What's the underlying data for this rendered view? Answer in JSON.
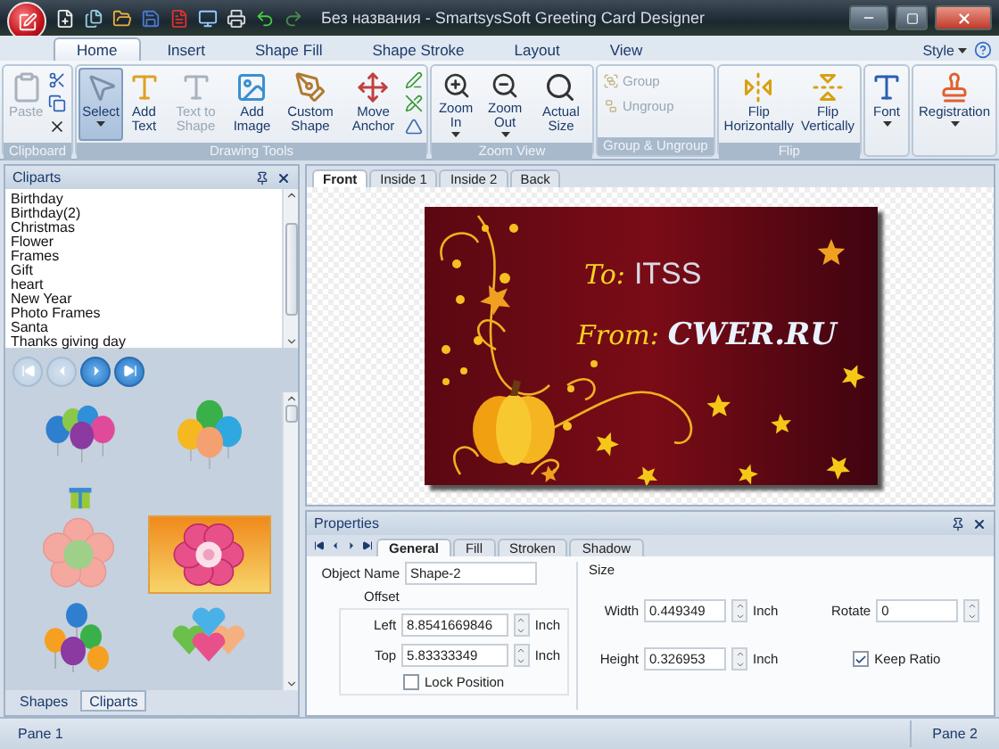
{
  "window": {
    "title": "Без названия - SmartsysSoft Greeting Card Designer"
  },
  "ribbon": {
    "tabs": [
      {
        "label": "Home",
        "selected": true
      },
      {
        "label": "Insert",
        "selected": false
      },
      {
        "label": "Shape Fill",
        "selected": false
      },
      {
        "label": "Shape Stroke",
        "selected": false
      },
      {
        "label": "Layout",
        "selected": false
      },
      {
        "label": "View",
        "selected": false
      }
    ],
    "style_menu": {
      "label": "Style"
    },
    "groups": [
      {
        "kind": "clipboard",
        "label": "Clipboard",
        "buttons": [
          {
            "kind": "large",
            "label": "Paste",
            "disabled": true
          }
        ]
      },
      {
        "kind": "drawing",
        "label": "Drawing Tools",
        "buttons": [
          {
            "kind": "large",
            "label": "Select",
            "disabled": false,
            "selected": true,
            "dropdown": true
          },
          {
            "kind": "large",
            "label": "Add Text",
            "disabled": false,
            "selected": false
          },
          {
            "kind": "large",
            "label": "Text to Shape",
            "disabled": true,
            "selected": false
          },
          {
            "kind": "large",
            "label": "Add Image",
            "disabled": false,
            "selected": false
          },
          {
            "kind": "large",
            "label": "Custom Shape",
            "disabled": false,
            "selected": false
          },
          {
            "kind": "large",
            "label": "Move Anchor",
            "disabled": false,
            "selected": false
          }
        ]
      },
      {
        "kind": "zoom",
        "label": "Zoom View",
        "buttons": [
          {
            "kind": "large",
            "label": "Zoom In",
            "disabled": false,
            "dropdown": true
          },
          {
            "kind": "large",
            "label": "Zoom Out",
            "disabled": false,
            "dropdown": true
          },
          {
            "kind": "large",
            "label": "Actual Size",
            "disabled": false
          }
        ]
      },
      {
        "kind": "grouping",
        "label": "Group & Ungroup",
        "buttons": [
          {
            "kind": "small",
            "label": "Group",
            "disabled": true
          },
          {
            "kind": "small",
            "label": "Ungroup",
            "disabled": true
          }
        ]
      },
      {
        "kind": "flip",
        "label": "Flip",
        "buttons": [
          {
            "kind": "large",
            "label": "Flip Horizontally",
            "disabled": false
          },
          {
            "kind": "large",
            "label": "Flip Vertically",
            "disabled": false
          }
        ]
      },
      {
        "kind": "font",
        "buttons": [
          {
            "kind": "large",
            "label": "Font",
            "disabled": false,
            "dropdown": true
          }
        ]
      },
      {
        "kind": "registration",
        "buttons": [
          {
            "kind": "large",
            "label": "Registration",
            "disabled": false,
            "dropdown": true
          }
        ]
      }
    ]
  },
  "cliparts_panel": {
    "title": "Cliparts",
    "categories": [
      {
        "label": "Birthday",
        "selected": false
      },
      {
        "label": "Birthday(2)",
        "selected": false
      },
      {
        "label": "Christmas",
        "selected": false
      },
      {
        "label": "Flower",
        "selected": false
      },
      {
        "label": "Frames",
        "selected": false
      },
      {
        "label": "Gift",
        "selected": false
      },
      {
        "label": "heart",
        "selected": false
      },
      {
        "label": "New Year",
        "selected": false
      },
      {
        "label": "Photo Frames",
        "selected": false
      },
      {
        "label": "Santa",
        "selected": false
      },
      {
        "label": "Thanks giving day",
        "selected": false
      }
    ],
    "pager": [
      {
        "kind": "first",
        "disabled": true
      },
      {
        "kind": "prev",
        "disabled": true
      },
      {
        "kind": "next",
        "disabled": false
      },
      {
        "kind": "last",
        "disabled": false
      }
    ],
    "thumbnails": [
      {
        "kind": "balloons",
        "selected": false
      },
      {
        "kind": "balloons_big",
        "selected": false
      },
      {
        "kind": "gift",
        "selected": false
      },
      {
        "kind": "flower",
        "selected": false
      },
      {
        "kind": "flower_hearts",
        "selected": true
      },
      {
        "kind": "balloons_small",
        "selected": false
      },
      {
        "kind": "hearts",
        "selected": false
      }
    ],
    "tabs": [
      {
        "label": "Shapes",
        "selected": false
      },
      {
        "label": "Cliparts",
        "selected": true
      }
    ]
  },
  "document_tabs": [
    {
      "label": "Front",
      "selected": true
    },
    {
      "label": "Inside 1",
      "selected": false
    },
    {
      "label": "Inside 2",
      "selected": false
    },
    {
      "label": "Back",
      "selected": false
    }
  ],
  "card": {
    "to_label": "To:",
    "to_value": "ITSS",
    "from_label": "From:",
    "from_value": "CWER.RU"
  },
  "properties": {
    "title": "Properties",
    "tabs": [
      {
        "label": "General",
        "selected": true
      },
      {
        "label": "Fill",
        "selected": false
      },
      {
        "label": "Stroken",
        "selected": false
      },
      {
        "label": "Shadow",
        "selected": false
      }
    ],
    "object_name": {
      "label": "Object Name",
      "value": "Shape-2"
    },
    "offset": {
      "title": "Offset",
      "left": {
        "label": "Left",
        "value": "8.8541669846",
        "unit": "Inch"
      },
      "top": {
        "label": "Top",
        "value": "5.83333349",
        "unit": "Inch"
      },
      "lock_position": {
        "label": "Lock Position",
        "checked": false
      }
    },
    "size": {
      "title": "Size",
      "width": {
        "label": "Width",
        "value": "0.449349",
        "unit": "Inch"
      },
      "height": {
        "label": "Height",
        "value": "0.326953",
        "unit": "Inch"
      },
      "rotate": {
        "label": "Rotate",
        "value": "0"
      },
      "keep_ratio": {
        "label": "Keep Ratio",
        "checked": true
      }
    }
  },
  "status_bar": {
    "left": "Pane 1",
    "right": "Pane 2"
  }
}
